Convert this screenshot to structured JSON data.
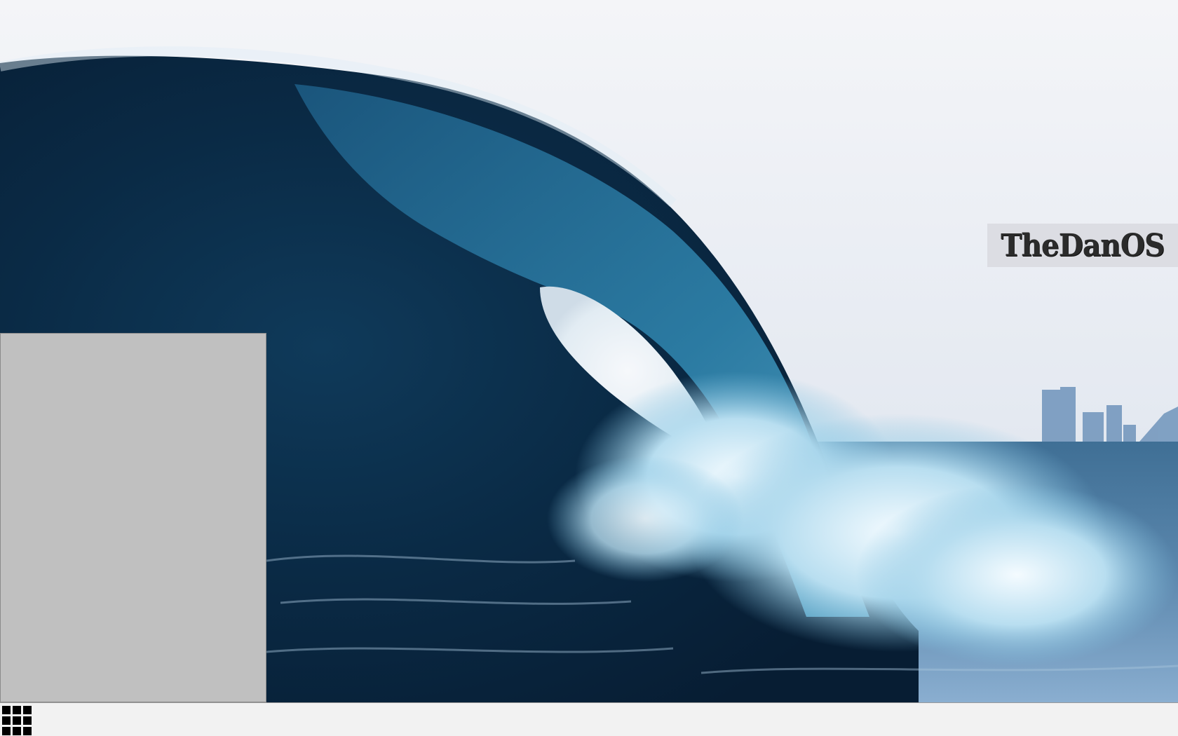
{
  "desktop": {
    "wallpaper": "ocean-wave-barrel",
    "brand": {
      "text": "TheDanOS"
    }
  },
  "start_menu": {
    "state": "open",
    "items": []
  },
  "taskbar": {
    "start_button_icon": "grid-icon",
    "colors": {
      "background": "#f2f2f2",
      "start_menu_bg": "#c0c0c0"
    }
  }
}
